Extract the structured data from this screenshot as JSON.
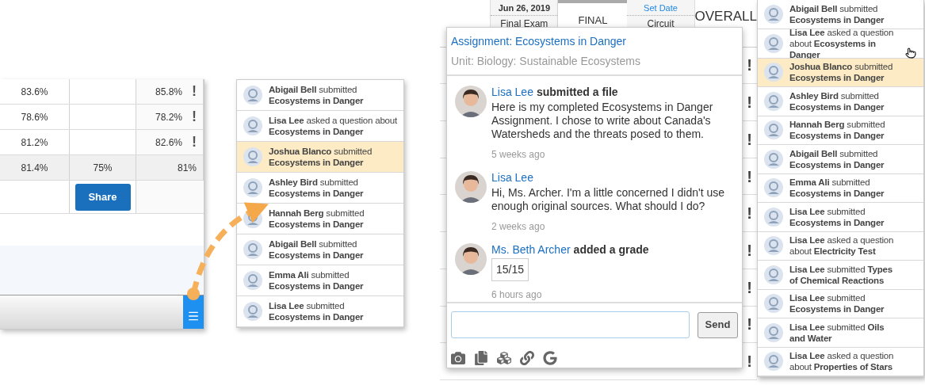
{
  "grade_panel": {
    "rows": [
      {
        "cells": [
          "83.6%",
          null,
          "85.8%"
        ],
        "flag": "!",
        "kind": "student"
      },
      {
        "cells": [
          "78.6%",
          null,
          "78.2%"
        ],
        "flag": "!",
        "kind": "student"
      },
      {
        "cells": [
          "81.2%",
          null,
          "82.6%"
        ],
        "flag": "!",
        "kind": "student"
      },
      {
        "cells": [
          "81.4%",
          "75%",
          "81%"
        ],
        "kind": "summary"
      }
    ],
    "share_button": "Share"
  },
  "notifications_small": [
    {
      "text": "**Abigail Bell** submitted **Ecosystems in Danger**",
      "selected": false
    },
    {
      "text": "**Lisa Lee** asked a question about **Ecosystems in Danger**",
      "selected": false
    },
    {
      "text": "**Joshua Blanco** submitted **Ecosystems in Danger**",
      "selected": true
    },
    {
      "text": "**Ashley Bird** submitted **Ecosystems in Danger**",
      "selected": false
    },
    {
      "text": "**Hannah Berg** submitted **Ecosystems in Danger**",
      "selected": false
    },
    {
      "text": "**Abigail Bell** submitted **Ecosystems in Danger**",
      "selected": false
    },
    {
      "text": "**Emma Ali** submitted **Ecosystems in Danger**",
      "selected": false
    },
    {
      "text": "**Lisa Lee** submitted **Ecosystems in Danger**",
      "selected": false
    }
  ],
  "gradebook": {
    "columns": [
      {
        "top": "Jun 26, 2019",
        "kind": "dated",
        "label": "Final Exam"
      },
      {
        "label": "FINAL",
        "kind": "tab"
      },
      {
        "top": "Set Date",
        "kind": "linked",
        "label": "Circuit"
      },
      {
        "label": "OVERALL",
        "kind": "overall"
      }
    ],
    "rows": [
      {
        "flag": "!"
      },
      {
        "flag": "!"
      },
      {
        "flag": "!"
      },
      {
        "flag": "!"
      },
      {
        "flag": "!"
      },
      {
        "flag": "!"
      },
      {
        "flag": "!"
      },
      {
        "flag": "!"
      },
      {
        "flag": "!"
      }
    ]
  },
  "popup": {
    "title": "Assignment: Ecosystems in Danger",
    "subtitle": "Unit: Biology: Sustainable Ecosystems",
    "messages": [
      {
        "author": "Lisa Lee",
        "action": "submitted a file",
        "body": "Here is my completed Ecosystems in Danger Assignment. I chose to write about Canada's Watersheds and the threats posed to them.",
        "time": "5 weeks ago"
      },
      {
        "author": "Lisa Lee",
        "body": "Hi, Ms. Archer. I'm a little concerned I didn't use enough original sources. What should I do?",
        "time": "2 weeks ago"
      },
      {
        "author": "Ms. Beth Archer",
        "action": "added a grade",
        "grade": "15/15",
        "time": "6 hours ago"
      }
    ],
    "send_button": "Send"
  },
  "notifications": [
    {
      "text": "**Abigail Bell** submitted **Ecosystems in Danger**",
      "selected": false
    },
    {
      "text": "**Lisa Lee** asked a question about **Ecosystems in Danger**",
      "selected": false
    },
    {
      "text": "**Joshua Blanco** submitted **Ecosystems in Danger**",
      "selected": true
    },
    {
      "text": "**Ashley Bird** submitted **Ecosystems in Danger**",
      "selected": false
    },
    {
      "text": "**Hannah Berg** submitted **Ecosystems in Danger**",
      "selected": false
    },
    {
      "text": "**Abigail Bell** submitted **Ecosystems in Danger**",
      "selected": false
    },
    {
      "text": "**Emma Ali** submitted **Ecosystems in Danger**",
      "selected": false
    },
    {
      "text": "**Lisa Lee** submitted **Ecosystems in Danger**",
      "selected": false
    },
    {
      "text": "**Lisa Lee** asked a question about **Electricity Test**",
      "selected": false
    },
    {
      "text": "**Lisa Lee** submitted **Types of Chemical Reactions**",
      "selected": false
    },
    {
      "text": "**Lisa Lee** submitted **Ecosystems in Danger**",
      "selected": false
    },
    {
      "text": "**Lisa Lee** submitted **Oils and Water**",
      "selected": false
    },
    {
      "text": "**Lisa Lee** asked a question about **Properties of Stars**",
      "selected": false
    }
  ]
}
